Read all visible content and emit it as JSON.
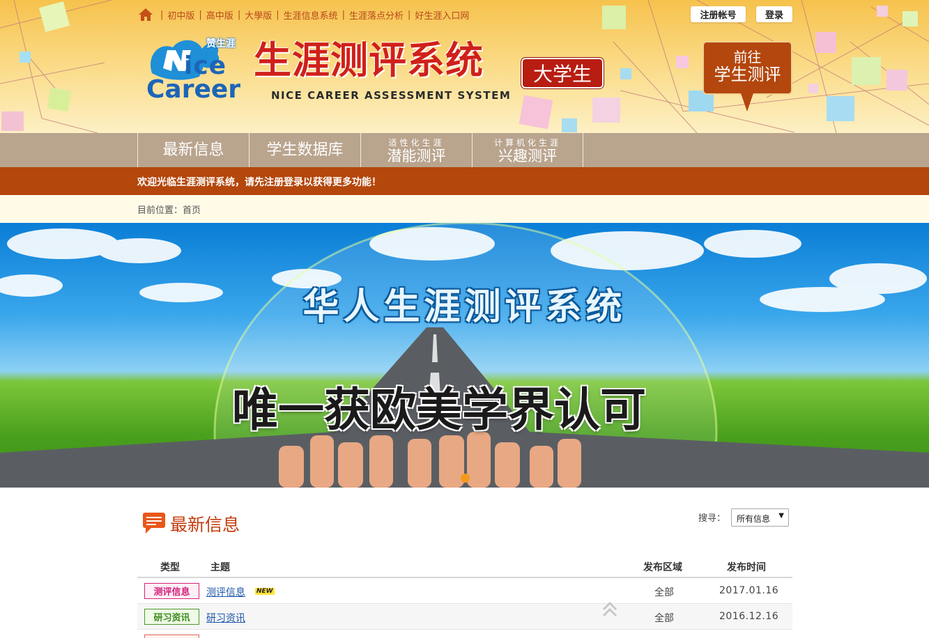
{
  "topnav": {
    "links": [
      "初中版",
      "高中版",
      "大學版",
      "生涯信息系统",
      "生涯落点分析",
      "好生涯入口网"
    ]
  },
  "auth": {
    "register_label": "注册帐号",
    "login_label": "登录"
  },
  "logo": {
    "brand_cn": "赞生涯",
    "line1": "Nice",
    "line2": "Career"
  },
  "site_title": {
    "cn": "生涯测评系统",
    "en": "NICE CAREER ASSESSMENT SYSTEM",
    "badge": "大学生"
  },
  "goto_button": {
    "line1": "前往",
    "line2": "学生测评"
  },
  "mainnav": {
    "items": [
      {
        "label": "最新信息"
      },
      {
        "label": "学生数据库"
      },
      {
        "small": "适性化生涯",
        "label": "潜能测评"
      },
      {
        "small": "计算机化生涯",
        "label": "兴趣测评"
      }
    ]
  },
  "welcome": "欢迎光临生涯测评系统，请先注册登录以获得更多功能！",
  "breadcrumb": {
    "prefix": "目前位置：",
    "current": "首页"
  },
  "banner": {
    "title": "华人生涯测评系统",
    "slogan": "唯一获欧美学界认可"
  },
  "news": {
    "title": "最新信息",
    "search_label": "搜寻：",
    "search_value": "所有信息",
    "columns": {
      "type": "类型",
      "subject": "主题",
      "region": "发布区域",
      "date": "发布时间"
    },
    "rows": [
      {
        "type": "测评信息",
        "subject": "测评信息",
        "new_badge": "NEW",
        "region": "全部",
        "date": "2017.01.16"
      },
      {
        "type": "研习资讯",
        "subject": "研习资讯",
        "region": "全部",
        "date": "2016.12.16"
      }
    ]
  },
  "colors": {
    "accent": "#b4470c",
    "title_red": "#d0201a",
    "nav_bg": "#b9a48e",
    "link_blue": "#1a55a8"
  }
}
